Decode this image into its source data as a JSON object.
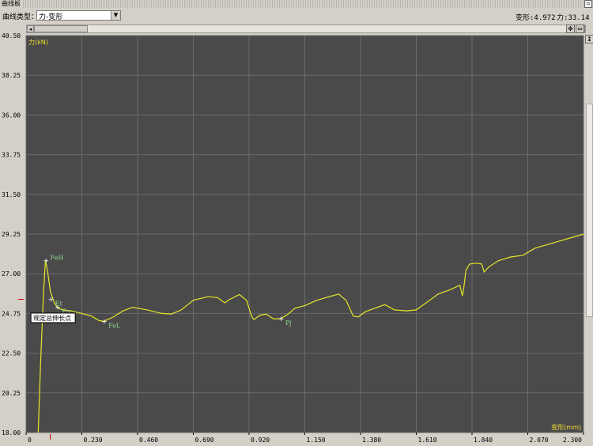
{
  "window": {
    "title": "曲线板"
  },
  "toolbar": {
    "curve_type_label": "曲线类型：",
    "curve_type_value": "力-变形",
    "deform_readout": "变形:4.972",
    "force_readout": "力:33.14"
  },
  "icons": {
    "dropdown": "chevron-down-icon",
    "scroll_left": "arrow-left-icon",
    "scroll_right": "arrow-right-icon",
    "zoom_fit": "zoom-fit-icon",
    "pan": "pan-icon"
  },
  "chart_data": {
    "type": "line",
    "xlabel": "变形(mm)",
    "ylabel": "力(kN)",
    "xlim": [
      0,
      2.3
    ],
    "ylim": [
      18.0,
      40.5
    ],
    "x_ticks": [
      "0",
      "0.230",
      "0.460",
      "0.690",
      "0.920",
      "1.150",
      "1.380",
      "1.610",
      "1.840",
      "2.070",
      "2.300"
    ],
    "y_ticks": [
      "18.00",
      "20.25",
      "22.50",
      "24.75",
      "27.00",
      "29.25",
      "31.50",
      "33.75",
      "36.00",
      "38.25",
      "40.50"
    ],
    "grid": true,
    "colors": {
      "background": "#4a4a4a",
      "grid": "#6b6b6b",
      "curve": "#e6e62a",
      "annotation": "#8fd88f",
      "axis_text": "#f0e030"
    },
    "series": [
      {
        "values": [
          [
            0.05,
            18.0
          ],
          [
            0.06,
            22.0
          ],
          [
            0.072,
            26.0
          ],
          [
            0.08,
            27.75
          ],
          [
            0.088,
            27.2
          ],
          [
            0.1,
            26.0
          ],
          [
            0.115,
            25.4
          ],
          [
            0.128,
            25.1
          ],
          [
            0.15,
            24.95
          ],
          [
            0.185,
            24.9
          ],
          [
            0.23,
            24.75
          ],
          [
            0.27,
            24.6
          ],
          [
            0.3,
            24.35
          ],
          [
            0.32,
            24.3
          ],
          [
            0.36,
            24.55
          ],
          [
            0.4,
            24.9
          ],
          [
            0.44,
            25.1
          ],
          [
            0.5,
            24.95
          ],
          [
            0.56,
            24.75
          ],
          [
            0.6,
            24.72
          ],
          [
            0.64,
            24.95
          ],
          [
            0.69,
            25.5
          ],
          [
            0.75,
            25.7
          ],
          [
            0.79,
            25.65
          ],
          [
            0.82,
            25.35
          ],
          [
            0.84,
            25.55
          ],
          [
            0.88,
            25.82
          ],
          [
            0.91,
            25.5
          ],
          [
            0.93,
            24.6
          ],
          [
            0.94,
            24.4
          ],
          [
            0.965,
            24.65
          ],
          [
            0.99,
            24.72
          ],
          [
            1.02,
            24.45
          ],
          [
            1.05,
            24.45
          ],
          [
            1.08,
            24.7
          ],
          [
            1.11,
            25.05
          ],
          [
            1.15,
            25.2
          ],
          [
            1.2,
            25.5
          ],
          [
            1.25,
            25.7
          ],
          [
            1.29,
            25.85
          ],
          [
            1.32,
            25.5
          ],
          [
            1.35,
            24.6
          ],
          [
            1.37,
            24.55
          ],
          [
            1.4,
            24.85
          ],
          [
            1.44,
            25.05
          ],
          [
            1.48,
            25.25
          ],
          [
            1.52,
            24.95
          ],
          [
            1.57,
            24.9
          ],
          [
            1.61,
            24.95
          ],
          [
            1.65,
            25.35
          ],
          [
            1.7,
            25.85
          ],
          [
            1.75,
            26.1
          ],
          [
            1.79,
            26.35
          ],
          [
            1.8,
            25.75
          ],
          [
            1.805,
            26.1
          ],
          [
            1.815,
            27.2
          ],
          [
            1.83,
            27.55
          ],
          [
            1.86,
            27.6
          ],
          [
            1.88,
            27.55
          ],
          [
            1.89,
            27.1
          ],
          [
            1.91,
            27.4
          ],
          [
            1.95,
            27.75
          ],
          [
            2.0,
            27.95
          ],
          [
            2.05,
            28.05
          ],
          [
            2.1,
            28.45
          ],
          [
            2.2,
            28.85
          ],
          [
            2.25,
            29.05
          ],
          [
            2.3,
            29.25
          ]
        ]
      }
    ],
    "annotations": [
      {
        "label": "FeH",
        "x": 0.08,
        "y": 27.75
      },
      {
        "label": "Et",
        "x": 0.1,
        "y": 25.55
      },
      {
        "label": "Fp",
        "x": 0.128,
        "y": 25.1
      },
      {
        "label": "FeL",
        "x": 0.32,
        "y": 24.3
      },
      {
        "label": "Pj",
        "x": 1.05,
        "y": 24.45
      }
    ],
    "tooltip": "规定总伸长点"
  }
}
